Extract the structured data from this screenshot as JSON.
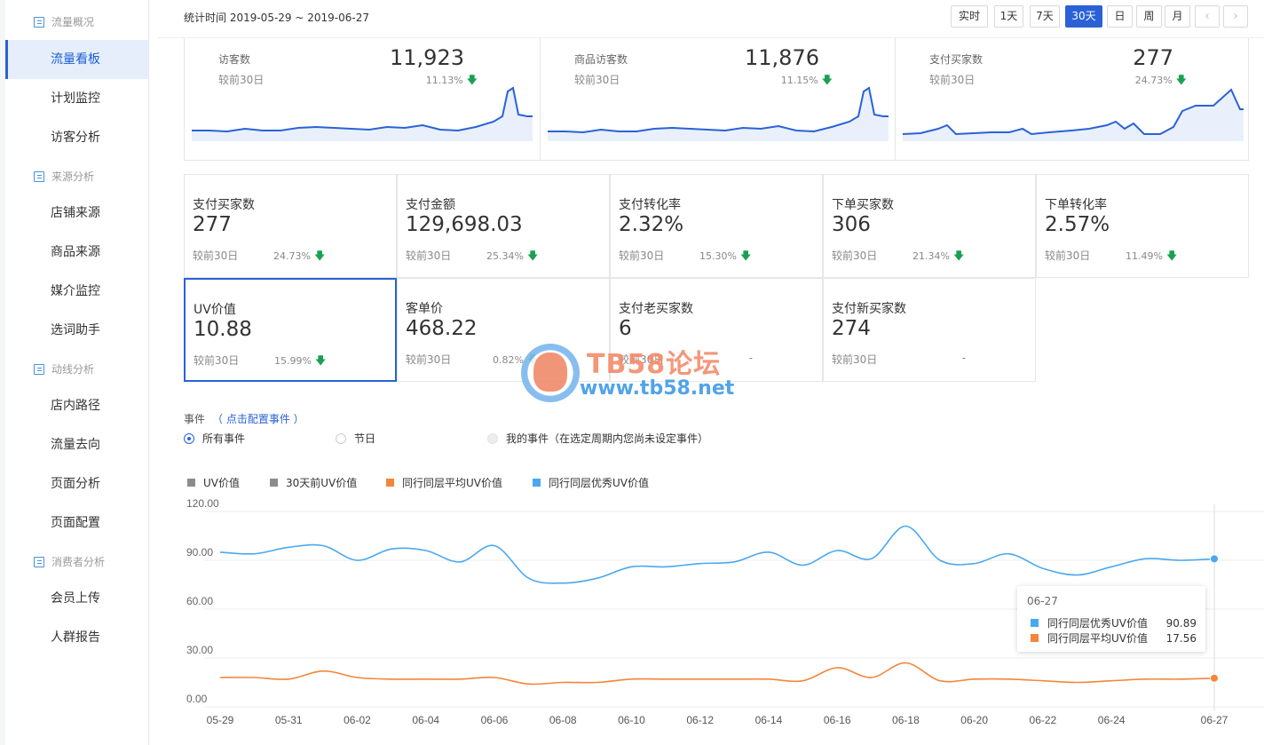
{
  "sidebar": {
    "groups": [
      {
        "label": "流量概况",
        "items": [
          "流量看板",
          "计划监控",
          "访客分析"
        ]
      },
      {
        "label": "来源分析",
        "items": [
          "店铺来源",
          "商品来源",
          "媒介监控",
          "选词助手"
        ]
      },
      {
        "label": "动线分析",
        "items": [
          "店内路径",
          "流量去向",
          "页面分析",
          "页面配置"
        ]
      },
      {
        "label": "消费者分析",
        "items": [
          "会员上传",
          "人群报告"
        ]
      }
    ],
    "active_item": "流量看板"
  },
  "header": {
    "period": "统计时间 2019-05-29 ~ 2019-06-27",
    "buttons": [
      "实时",
      "1天",
      "7天",
      "30天",
      "日",
      "周",
      "月"
    ],
    "active_button": "30天",
    "prev": "‹",
    "next": "›"
  },
  "spark_cards": [
    {
      "label": "访客数",
      "value": "11,923",
      "compare": "较前30日",
      "change": "11.13%",
      "arrow": "🡇"
    },
    {
      "label": "商品访客数",
      "value": "11,876",
      "compare": "较前30日",
      "change": "11.15%",
      "arrow": "🡇"
    },
    {
      "label": "支付买家数",
      "value": "277",
      "compare": "较前30日",
      "change": "24.73%",
      "arrow": "🡇"
    }
  ],
  "metrics": [
    {
      "title": "支付买家数",
      "value": "277",
      "compare": "较前30日",
      "change": "24.73%",
      "arrow": "🡇"
    },
    {
      "title": "支付金额",
      "value": "129,698.03",
      "compare": "较前30日",
      "change": "25.34%",
      "arrow": "🡇"
    },
    {
      "title": "支付转化率",
      "value": "2.32%",
      "compare": "较前30日",
      "change": "15.30%",
      "arrow": "🡇"
    },
    {
      "title": "下单买家数",
      "value": "306",
      "compare": "较前30日",
      "change": "21.34%",
      "arrow": "🡇"
    },
    {
      "title": "下单转化率",
      "value": "2.57%",
      "compare": "较前30日",
      "change": "11.49%",
      "arrow": "🡇"
    },
    {
      "title": "UV价值",
      "value": "10.88",
      "compare": "较前30日",
      "change": "15.99%",
      "arrow": "🡇"
    },
    {
      "title": "客单价",
      "value": "468.22",
      "compare": "较前30日",
      "change": "0.82%",
      "arrow": "🡇"
    },
    {
      "title": "支付老买家数",
      "value": "6",
      "compare": "较前30日",
      "change": "-",
      "arrow": ""
    },
    {
      "title": "支付新买家数",
      "value": "274",
      "compare": "较前30日",
      "change": "-",
      "arrow": ""
    }
  ],
  "events": {
    "title": "事件",
    "link": "（ 点击配置事件 ）",
    "options": [
      "所有事件",
      "节日",
      "我的事件（在选定周期内您尚未设定事件）"
    ],
    "selected": "所有事件"
  },
  "watermark": {
    "title": "TB58论坛",
    "url": "www.tb58.net"
  },
  "colors": {
    "accent": "#2a62d6",
    "down": "#1aa052",
    "excellent": "#4aa8f0",
    "average": "#f5853a",
    "gray": "#8c8c8c"
  },
  "chart_data": {
    "type": "line",
    "legend": [
      "UV价值",
      "30天前UV价值",
      "同行同层平均UV价值",
      "同行同层优秀UV价值"
    ],
    "legend_colors": [
      "#8c8c8c",
      "#8c8c8c",
      "#f5853a",
      "#4aa8f0"
    ],
    "y_ticks": [
      "120.00",
      "90.00",
      "60.00",
      "30.00",
      "0.00"
    ],
    "ylim": [
      0,
      120
    ],
    "x_labels": [
      "05-29",
      "05-31",
      "06-02",
      "06-04",
      "06-06",
      "06-08",
      "06-10",
      "06-12",
      "06-14",
      "06-16",
      "06-18",
      "06-20",
      "06-22",
      "06-24",
      "06-27"
    ],
    "x": [
      "05-29",
      "05-30",
      "05-31",
      "06-01",
      "06-02",
      "06-03",
      "06-04",
      "06-05",
      "06-06",
      "06-07",
      "06-08",
      "06-09",
      "06-10",
      "06-11",
      "06-12",
      "06-13",
      "06-14",
      "06-15",
      "06-16",
      "06-17",
      "06-18",
      "06-19",
      "06-20",
      "06-21",
      "06-22",
      "06-23",
      "06-24",
      "06-25",
      "06-26",
      "06-27"
    ],
    "series": [
      {
        "name": "同行同层优秀UV价值",
        "color": "#4aa8f0",
        "values": [
          95,
          94,
          98,
          99,
          90,
          97,
          96,
          89,
          99,
          79,
          76,
          79,
          86,
          86,
          88,
          89,
          95,
          87,
          96,
          91,
          111,
          90,
          88,
          94,
          85,
          81,
          86,
          91,
          90,
          90.89
        ]
      },
      {
        "name": "同行同层平均UV价值",
        "color": "#f5853a",
        "values": [
          18,
          18,
          17,
          22,
          18,
          17,
          17,
          17,
          18,
          14,
          15,
          15,
          17,
          17,
          17,
          17,
          17,
          16,
          24,
          18,
          27,
          16,
          17,
          17,
          16,
          15,
          16,
          17,
          17,
          17.56
        ]
      }
    ],
    "tooltip": {
      "date": "06-27",
      "rows": [
        {
          "name": "同行同层优秀UV价值",
          "value": "90.89",
          "color": "#4aa8f0"
        },
        {
          "name": "同行同层平均UV价值",
          "value": "17.56",
          "color": "#f5853a"
        }
      ]
    }
  }
}
